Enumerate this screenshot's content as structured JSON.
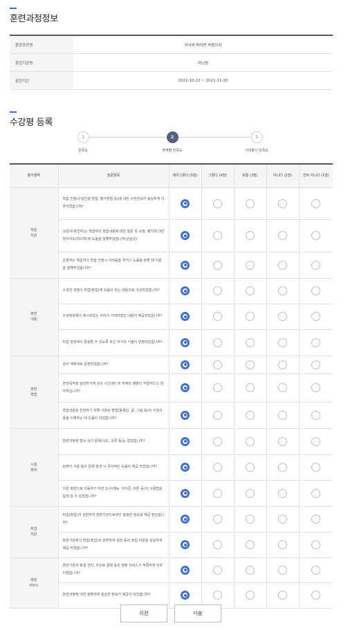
{
  "sections": {
    "course_info_title": "훈련과정정보",
    "review_title": "수강평 등록"
  },
  "course_info": [
    {
      "label": "훈련과정명",
      "value": "아서와 파이썬 처음이지"
    },
    {
      "label": "훈련기관명",
      "value": "러닝핏"
    },
    {
      "label": "훈련기간",
      "value": "2021-10-22 ~ 2021-11-20"
    }
  ],
  "steps": [
    {
      "num": "1",
      "label": "만족도",
      "active": false
    },
    {
      "num": "2",
      "label": "영역별 만족도",
      "active": true
    },
    {
      "num": "3",
      "label": "기대평가 만족도",
      "active": false
    }
  ],
  "table": {
    "col_area": "평가영역",
    "col_question": "질문항목",
    "scale": [
      "매우그렇다 (5점)",
      "그렇다 (4점)",
      "보통 (3점)",
      "아니다 (2점)",
      "전혀 아니다 (1점)"
    ]
  },
  "groups": [
    {
      "area": "학습\n지원",
      "questions": [
        "학습 진행(수업진행 방법, 평가방법 등)에 대한 사전안내가 충실하게 이루어졌습니까?",
        "교강사(촉진자)는 학습자의 학습내용에 대한 질문 및 요청, 평가에 대한 첨삭지도(피드백)에 도움을 잘해주었습니까(성실성)",
        "운영자는 학습자가 학습 진행시 어려움을 겪거나 도움을 청할 때 지원을 잘해주었습니까?"
      ],
      "answers": [
        0,
        0,
        0
      ]
    },
    {
      "area": "훈련\n내용",
      "questions": [
        "수강한 과정이 취업(창업)에 도움이 되는 내용으로 구성되었습니까?",
        "수강정보에서 제시되었는 귀하가 기대하였던 내용이 제공되었습니까?",
        "직업 현장에서 활용할 수 있도록 최신 지식과 기술이 반영되었습니까?"
      ],
      "answers": [
        0,
        0,
        0
      ]
    },
    {
      "area": "훈련\n방법",
      "questions": [
        "강의 계획대로 운영되었습니까?",
        "훈련목적을 달성하기에 강의 시간(량) 및 주제의 배분이 적절하다고 생각하십니까?",
        "학습내용을 전달하기 위해 사용된 방법(동영상, 글, 그림 등)이 수강내용을 이해하는 데 도움이 되었습니까?"
      ],
      "answers": [
        0,
        0,
        0
      ]
    },
    {
      "area": "시설\n장비",
      "questions": [
        "훈련과정에 접속 상의 문제(속도, 오류 등)는 없었습니까?",
        "컴퓨터 사용 등의 문제 발생 시 즉각적인 도움이 제공 되었습니까?",
        "다른 화면으로 이동하기 위한 도구(메뉴, 아이콘, 버튼 등)의 사용법을 쉽게 알 수 있었습니까?"
      ],
      "answers": [
        0,
        0,
        0
      ]
    },
    {
      "area": "취업\n지원",
      "questions": [
        "취업(창업)과 관련하여 훈련기관으로부터 충분한 정보를 제공 받았습니까?",
        "훈련기관에서 취업(창업)과 관련하여 상담 등의 취업 지원을 성실하게 제공 하였습니까?"
      ],
      "answers": [
        0,
        0
      ]
    },
    {
      "area": "행정\n서비스",
      "questions": [
        "훈련기관의 출결 관리, 수강료 결제 등의 행정 서비스가 적절하게 이루어졌습니까?",
        "훈련과정에 대한 정확하며 충실한 정보가 제공이 되었습니까?"
      ],
      "answers": [
        0,
        0
      ]
    }
  ],
  "buttons": {
    "prev": "이전",
    "next": "다음"
  },
  "colors": {
    "accent": "#3a6fd8",
    "step_active": "#52607a"
  }
}
